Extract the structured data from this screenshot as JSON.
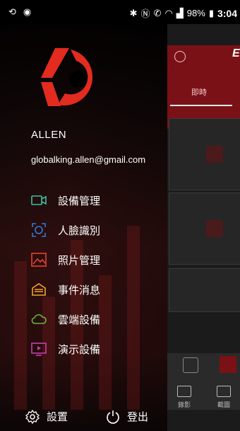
{
  "status_bar": {
    "battery": "98%",
    "time": "3:04"
  },
  "drawer": {
    "username": "ALLEN",
    "email": "globalking.allen@gmail.com",
    "menu": [
      {
        "label": "設備管理",
        "icon": "camera-icon",
        "color": "#3cc2a4"
      },
      {
        "label": "人臉識別",
        "icon": "face-scan-icon",
        "color": "#2f7bd8"
      },
      {
        "label": "照片管理",
        "icon": "photo-icon",
        "color": "#e8402d"
      },
      {
        "label": "事件消息",
        "icon": "message-icon",
        "color": "#f3a623"
      },
      {
        "label": "雲端設備",
        "icon": "cloud-icon",
        "color": "#63b53f"
      },
      {
        "label": "演示設備",
        "icon": "demo-play-icon",
        "color": "#c43fb0"
      }
    ],
    "footer": {
      "settings_label": "設置",
      "logout_label": "登出"
    }
  },
  "background_app": {
    "tab_label": "即時",
    "record_label": "錄影",
    "screenshot_label": "截圖"
  }
}
